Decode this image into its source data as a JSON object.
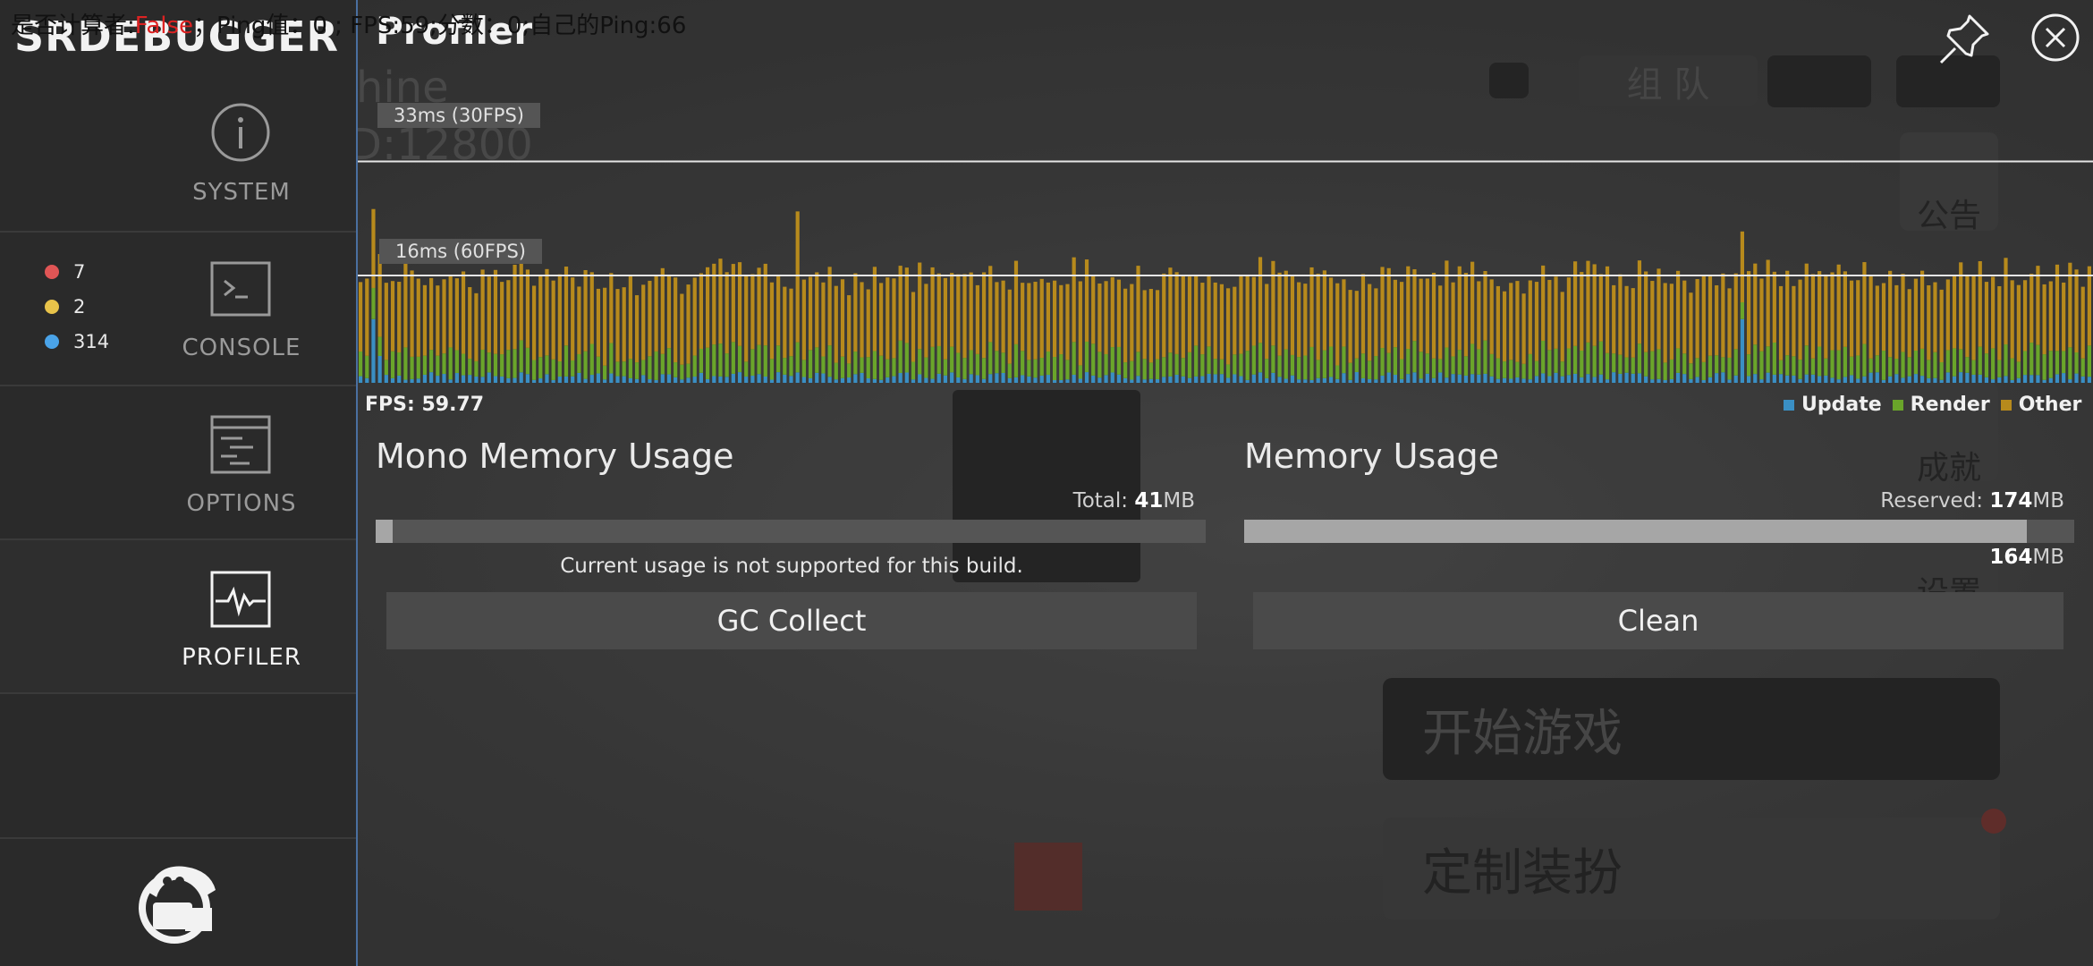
{
  "debug_bar": {
    "prefix": "是否计算者:",
    "flag": "False",
    "rest": "；Ping值：0 ; FPS:59;分数：0;自己的Ping:66"
  },
  "background": {
    "text_left": "hine",
    "text_id": "D:12800",
    "btn_group": "组 队",
    "announce": "公告",
    "achieve": "成就",
    "settings": "设置",
    "start_game": "开始游戏",
    "custom_outfit": "定制装扮"
  },
  "sidebar": {
    "logo": "SRDEBUGGER",
    "items": [
      {
        "label": "SYSTEM",
        "icon": "info-icon"
      },
      {
        "label": "CONSOLE",
        "icon": "terminal-icon"
      },
      {
        "label": "OPTIONS",
        "icon": "options-icon"
      },
      {
        "label": "PROFILER",
        "icon": "pulse-icon"
      }
    ],
    "console_counts": {
      "error": "7",
      "warning": "2",
      "info": "314"
    },
    "colors": {
      "error": "#e05555",
      "warning": "#e8c34a",
      "info": "#4aa3e8"
    }
  },
  "header": {
    "title": "Profiler"
  },
  "profiler": {
    "fps_label": "FPS: 59.77",
    "ref_33": "33ms (30FPS)",
    "ref_16": "16ms (60FPS)",
    "legend": [
      {
        "name": "Update",
        "color": "#3a8fc4"
      },
      {
        "name": "Render",
        "color": "#6aa52a"
      },
      {
        "name": "Other",
        "color": "#b78a1c"
      }
    ]
  },
  "chart_data": {
    "type": "bar",
    "title": "",
    "xlabel": "",
    "ylabel": "",
    "ylim": [
      0,
      40
    ],
    "reference_lines_ms": [
      33,
      16
    ],
    "series": [
      {
        "name": "Update",
        "values_ms_typical": 1,
        "spike_ms": 11
      },
      {
        "name": "Render",
        "values_ms_typical": 3.5
      },
      {
        "name": "Other",
        "values_ms_typical": 11.5,
        "spike_ms": 28
      }
    ],
    "bar_count": 270
  },
  "mono_memory": {
    "title": "Mono Memory Usage",
    "total_prefix": "Total: ",
    "total_value": "41",
    "total_unit": "MB",
    "fill_fraction": 0.02,
    "unsupported_text": "Current usage is not supported for this build.",
    "button": "GC Collect"
  },
  "memory": {
    "title": "Memory Usage",
    "reserved_prefix": "Reserved: ",
    "reserved_value": "174",
    "reserved_unit": "MB",
    "used_value": "164",
    "used_unit": "MB",
    "fill_fraction": 0.943,
    "button": "Clean"
  }
}
